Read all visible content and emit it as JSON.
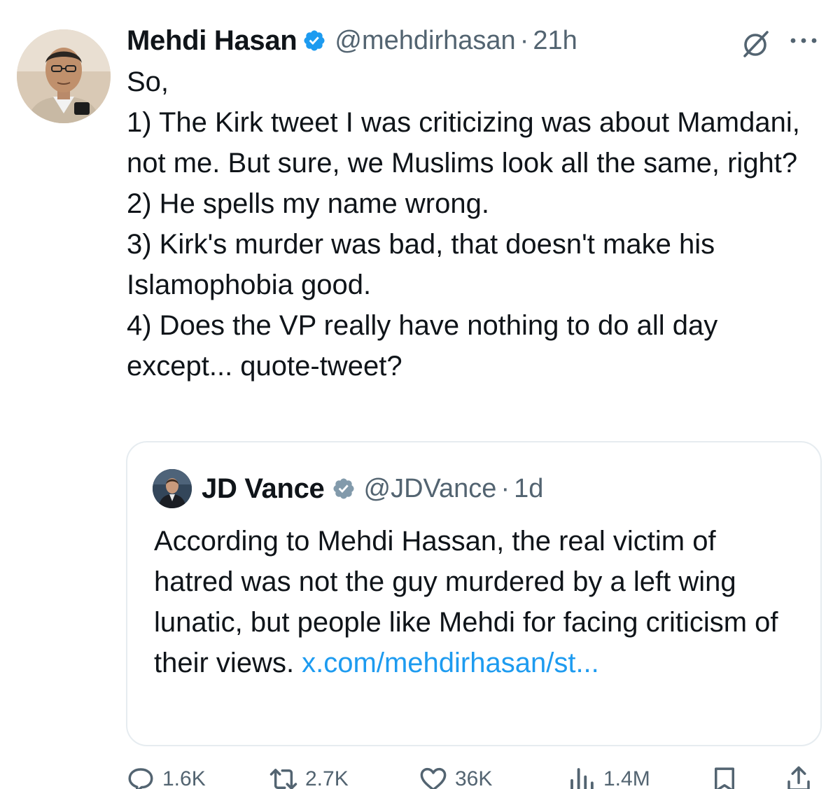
{
  "tweet": {
    "author_name": "Mehdi Hasan",
    "author_handle": "@mehdirhasan",
    "separator": "·",
    "time": "21h",
    "body": "So,\n1) The Kirk tweet I was criticizing was about Mamdani, not me. But sure, we Muslims look all the same, right?\n2) He spells my name wrong.\n3) Kirk's murder was bad, that doesn't make his Islamophobia good.\n4) Does the VP really have nothing to do all day except... quote-tweet?"
  },
  "quote": {
    "author_name": "JD Vance",
    "author_handle": "@JDVance",
    "separator": "·",
    "time": "1d",
    "body": "According to Mehdi Hassan, the real victim of hatred was not the guy murdered by a left wing lunatic, but people like Mehdi for facing criticism of their views. ",
    "link": "x.com/mehdirhasan/st..."
  },
  "actions": {
    "replies": "1.6K",
    "retweets": "2.7K",
    "likes": "36K",
    "views": "1.4M"
  },
  "icons": {
    "verified": "verified-badge-icon",
    "grok": "grok-icon",
    "more": "more-icon",
    "reply": "reply-icon",
    "retweet": "retweet-icon",
    "like": "heart-icon",
    "views": "views-icon",
    "bookmark": "bookmark-icon",
    "share": "share-icon"
  },
  "colors": {
    "text": "#0f1419",
    "secondary": "#536471",
    "link": "#1d9bf0",
    "verified_blue": "#1d9bf0",
    "verified_gray": "#829aab",
    "border": "#e6ecf0"
  }
}
